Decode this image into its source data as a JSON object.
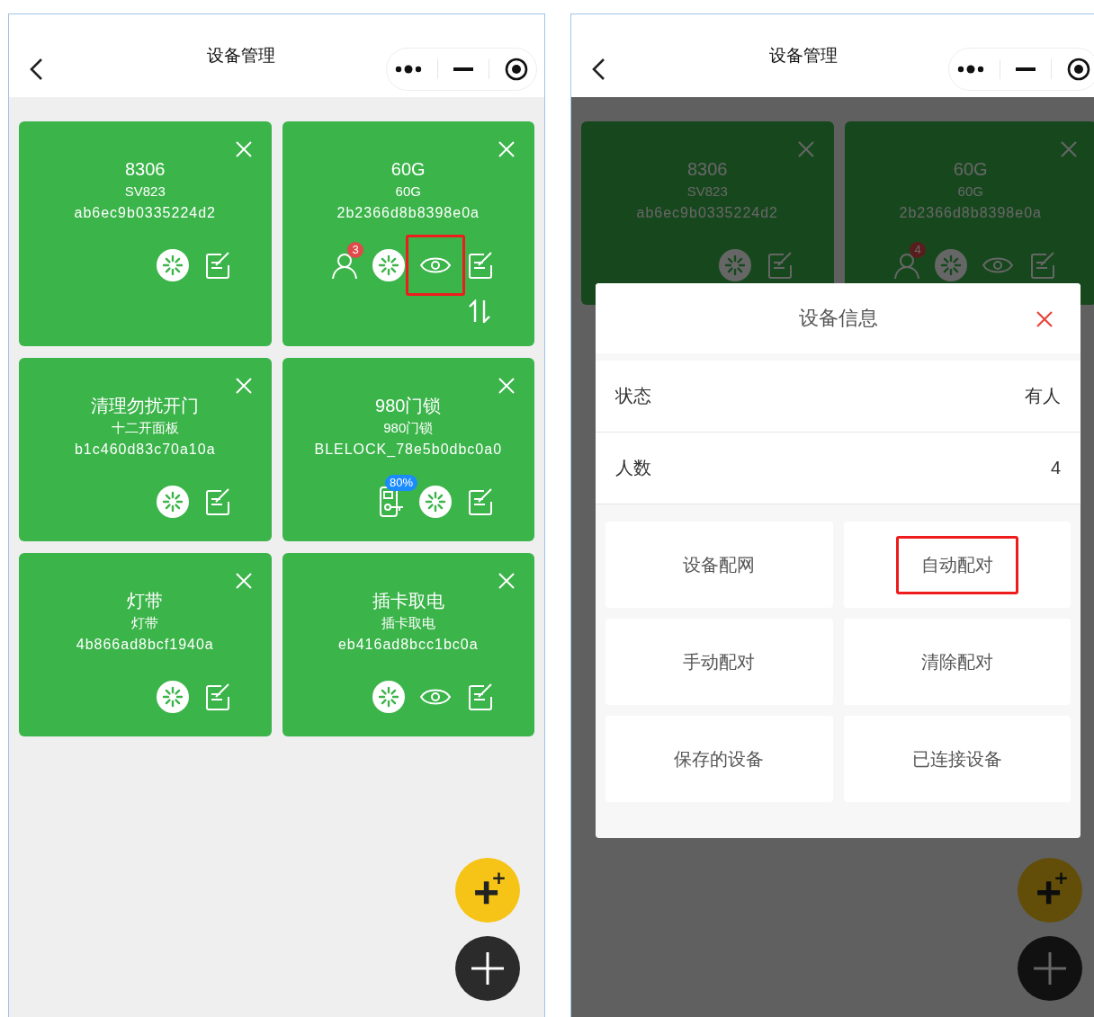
{
  "screens": [
    {
      "title": "设备管理",
      "devices": [
        {
          "name": "8306",
          "model": "SV823",
          "id": "ab6ec9b0335224d2",
          "icons": [
            {
              "kind": "aperture"
            },
            {
              "kind": "edit"
            }
          ],
          "sortable": false
        },
        {
          "name": "60G",
          "model": "60G",
          "id": "2b2366d8b8398e0a",
          "icons": [
            {
              "kind": "person",
              "badge": "3"
            },
            {
              "kind": "aperture"
            },
            {
              "kind": "eye",
              "highlighted": true
            },
            {
              "kind": "edit"
            }
          ],
          "sortable": true
        },
        {
          "name": "清理勿扰开门",
          "model": "十二开面板",
          "id": "b1c460d83c70a10a",
          "icons": [
            {
              "kind": "aperture"
            },
            {
              "kind": "edit"
            }
          ],
          "sortable": false
        },
        {
          "name": "980门锁",
          "model": "980门锁",
          "id": "BLELOCK_78e5b0dbc0a0",
          "icons": [
            {
              "kind": "lock",
              "badge": "80%"
            },
            {
              "kind": "aperture"
            },
            {
              "kind": "edit"
            }
          ],
          "sortable": false
        },
        {
          "name": "灯带",
          "model": "灯带",
          "id": "4b866ad8bcf1940a",
          "icons": [
            {
              "kind": "aperture"
            },
            {
              "kind": "edit"
            }
          ],
          "sortable": false
        },
        {
          "name": "插卡取电",
          "model": "插卡取电",
          "id": "eb416ad8bcc1bc0a",
          "icons": [
            {
              "kind": "aperture"
            },
            {
              "kind": "eye",
              "highlighted": false
            },
            {
              "kind": "edit"
            }
          ],
          "sortable": false
        }
      ],
      "fabs": [
        {
          "kind": "quick-add"
        },
        {
          "kind": "add"
        }
      ]
    },
    {
      "title": "设备管理",
      "devices": [
        {
          "name": "8306",
          "model": "SV823",
          "id": "ab6ec9b0335224d2",
          "icons": [
            {
              "kind": "aperture"
            },
            {
              "kind": "edit"
            }
          ],
          "sortable": false
        },
        {
          "name": "60G",
          "model": "60G",
          "id": "2b2366d8b8398e0a",
          "icons": [
            {
              "kind": "person",
              "badge": "4"
            },
            {
              "kind": "aperture"
            },
            {
              "kind": "eye",
              "highlighted": false
            },
            {
              "kind": "edit"
            }
          ],
          "sortable": false
        }
      ],
      "fabs": [
        {
          "kind": "quick-add"
        },
        {
          "kind": "add"
        }
      ],
      "modal": {
        "title": "设备信息",
        "rows": [
          {
            "label": "状态",
            "value": "有人"
          },
          {
            "label": "人数",
            "value": "4"
          }
        ],
        "actions": [
          {
            "label": "设备配网",
            "highlighted": false
          },
          {
            "label": "自动配对",
            "highlighted": true
          },
          {
            "label": "手动配对",
            "highlighted": false
          },
          {
            "label": "清除配对",
            "highlighted": false
          },
          {
            "label": "保存的设备",
            "highlighted": false
          },
          {
            "label": "已连接设备",
            "highlighted": false
          }
        ]
      }
    }
  ]
}
